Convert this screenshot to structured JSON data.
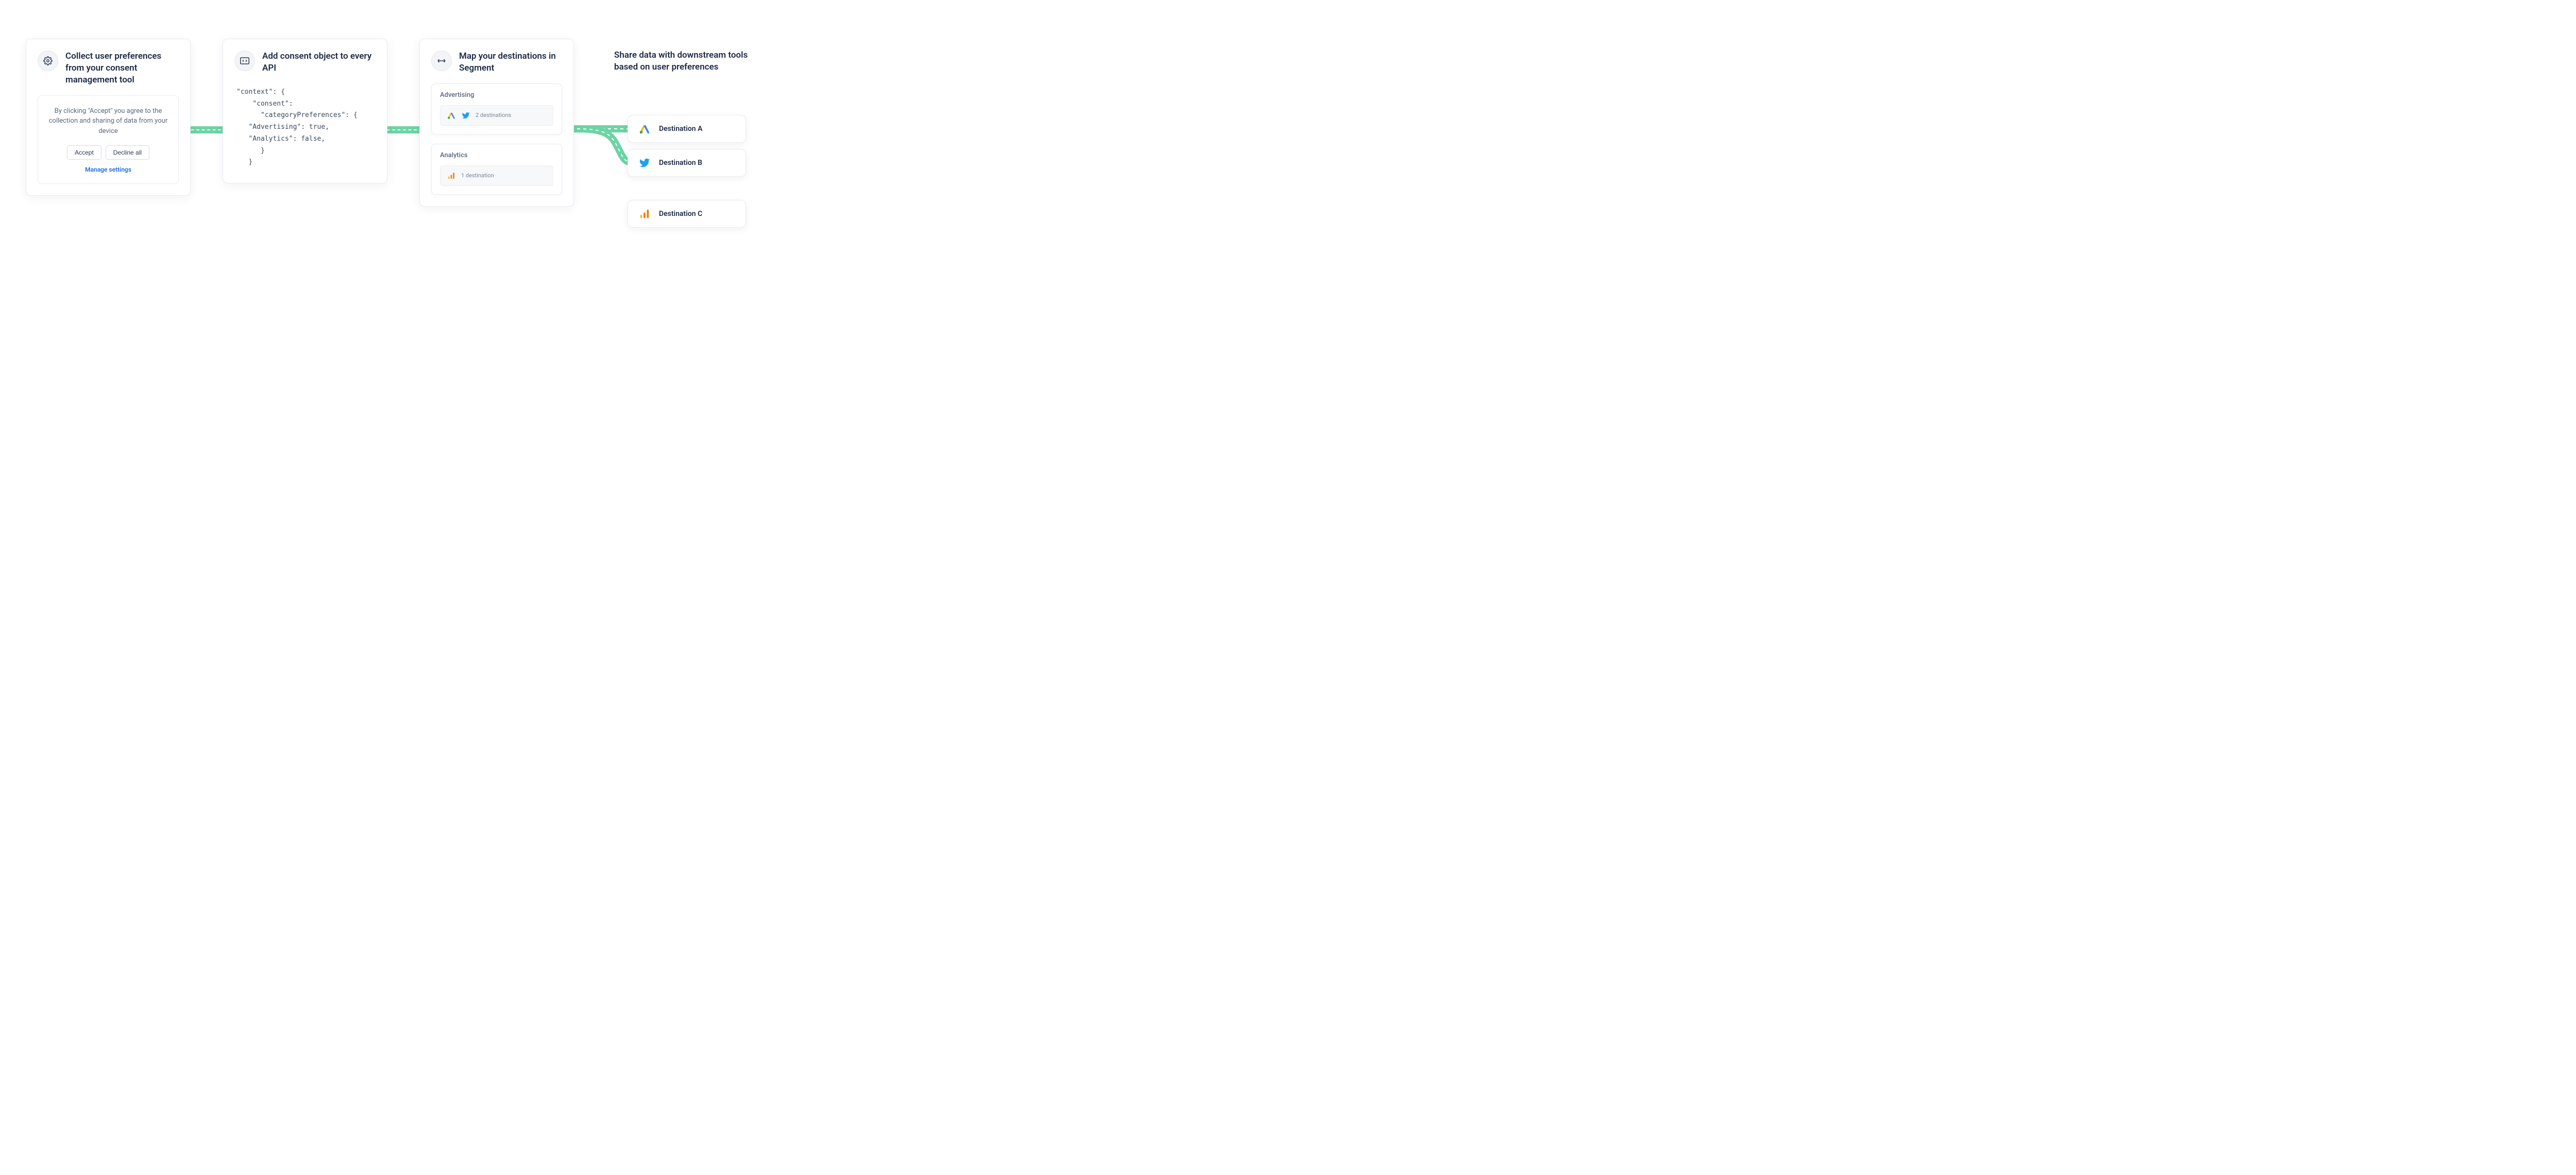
{
  "steps": {
    "collect": {
      "title": "Collect user preferences from your consent management tool",
      "consent_text": "By clicking \"Accept\" you agree to the collection and sharing of data from your device",
      "accept_label": "Accept",
      "decline_label": "Decline all",
      "manage_label": "Manage settings"
    },
    "add_consent": {
      "title": "Add consent object to every API",
      "code": "\"context\": {\n    \"consent\":\n      \"categoryPreferences\": {\n   \"Advertising\": true,\n   \"Analytics\": false,\n      }\n   }"
    },
    "map": {
      "title": "Map your destinations in Segment",
      "groups": [
        {
          "name": "Advertising",
          "count_label": "2 destinations",
          "icons": [
            "google-ads",
            "twitter"
          ]
        },
        {
          "name": "Analytics",
          "count_label": "1 destination",
          "icons": [
            "google-analytics"
          ]
        }
      ]
    },
    "share": {
      "title": "Share data with downstream tools based on user preferences",
      "destinations": [
        {
          "label": "Destination A",
          "icon": "google-ads"
        },
        {
          "label": "Destination B",
          "icon": "twitter"
        },
        {
          "label": "Destination C",
          "icon": "google-analytics"
        }
      ]
    }
  },
  "colors": {
    "connector": "#6dd4a4",
    "accent_blue": "#1f6fe5",
    "text_primary": "#1c2a46",
    "text_secondary": "#5a6880"
  }
}
